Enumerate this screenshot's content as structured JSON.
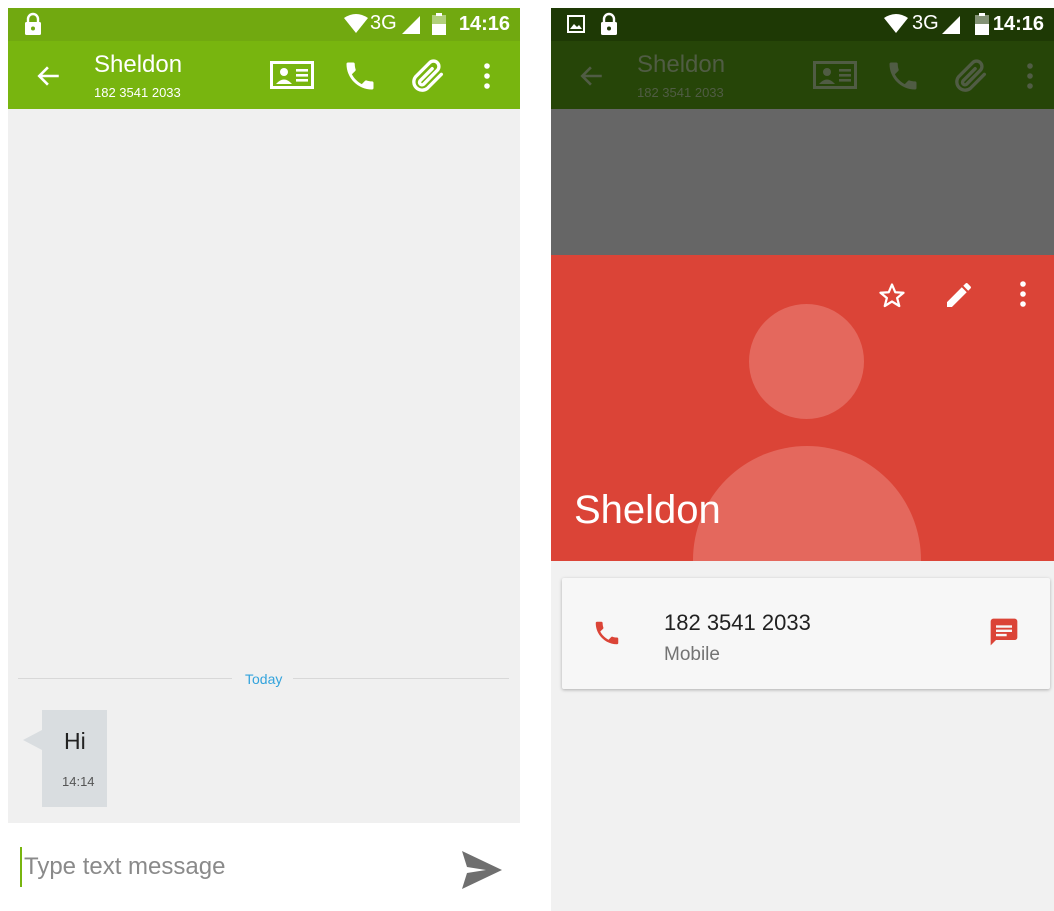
{
  "status_bar": {
    "time": "14:16",
    "network": "3G",
    "icons": [
      "lock-icon",
      "wifi-icon",
      "signal-icon",
      "battery-icon",
      "image-notification-icon"
    ]
  },
  "conversation": {
    "contact_name": "Sheldon",
    "contact_number": "182 3541 2033",
    "toolbar_icons": [
      "back-arrow-icon",
      "contact-card-icon",
      "phone-icon",
      "paperclip-icon",
      "overflow-menu-icon"
    ],
    "date_separator": "Today",
    "messages": [
      {
        "text": "Hi",
        "time": "14:14",
        "direction": "incoming"
      }
    ],
    "composer": {
      "placeholder": "Type text message",
      "value": "",
      "send_icon": "send-icon"
    }
  },
  "contact": {
    "name": "Sheldon",
    "actions": [
      "star-icon",
      "edit-pencil-icon",
      "overflow-menu-icon"
    ],
    "phone": {
      "number": "182 3541 2033",
      "type": "Mobile"
    }
  },
  "colors": {
    "toolbar_green": "#78b50f",
    "statusbar_green": "#71a910",
    "dimmed_toolbar": "#264508",
    "hero_red": "#db4437",
    "date_blue": "#33a3dc"
  }
}
